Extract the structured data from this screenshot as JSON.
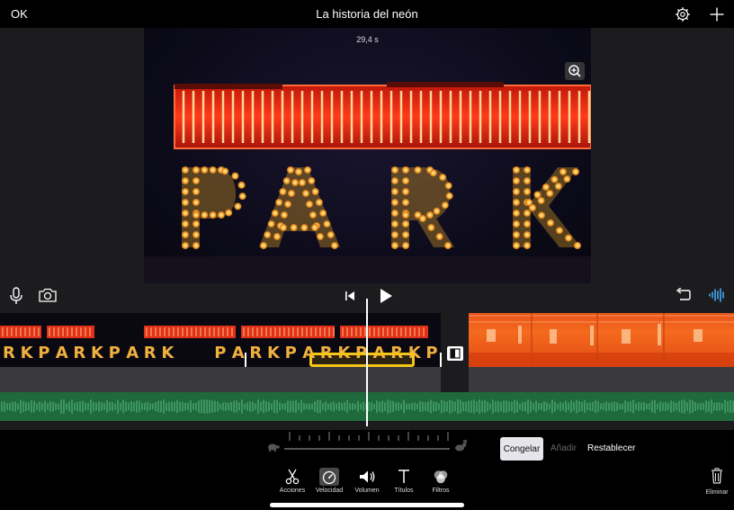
{
  "topbar": {
    "ok_label": "OK",
    "title": "La historia del neón",
    "settings_icon": "gear-icon",
    "add_icon": "plus-icon"
  },
  "viewer": {
    "duration": "29,4 s",
    "zoom_icon": "zoom-in-icon",
    "sign_text": "PARK"
  },
  "controls": {
    "mic_icon": "microphone-icon",
    "camera_icon": "camera-icon",
    "skip_back_icon": "skip-to-start-icon",
    "play_icon": "play-icon",
    "undo_icon": "undo-icon",
    "audio_icon": "waveform-icon"
  },
  "timeline": {
    "clip_a_letters": [
      "R",
      "K",
      "P",
      "A",
      "R",
      "K",
      "P",
      "A",
      "R",
      "K",
      "",
      "",
      "P",
      "A",
      "R",
      "K",
      "P",
      "A",
      "R",
      "K",
      "P",
      "A",
      "R",
      "K",
      "P"
    ],
    "transition_icon": "transition-icon"
  },
  "speed": {
    "slow_icon": "turtle-icon",
    "fast_icon": "rabbit-icon"
  },
  "actions": {
    "freeze": "Congelar",
    "add": "Añadir",
    "reset": "Restablecer"
  },
  "tools": [
    {
      "label": "Acciones",
      "icon": "scissors-icon"
    },
    {
      "label": "Velocidad",
      "icon": "speedometer-icon"
    },
    {
      "label": "Volumen",
      "icon": "speaker-icon"
    },
    {
      "label": "Títulos",
      "icon": "text-icon"
    },
    {
      "label": "Filtros",
      "icon": "filters-icon"
    }
  ],
  "delete_label": "Eliminar",
  "colors": {
    "accent": "#3fa9f5",
    "selection": "#f5c518",
    "audio_track": "#1e6a3c",
    "neon_red": "#ff3a1a",
    "bulb_yellow": "#ffc24a"
  }
}
